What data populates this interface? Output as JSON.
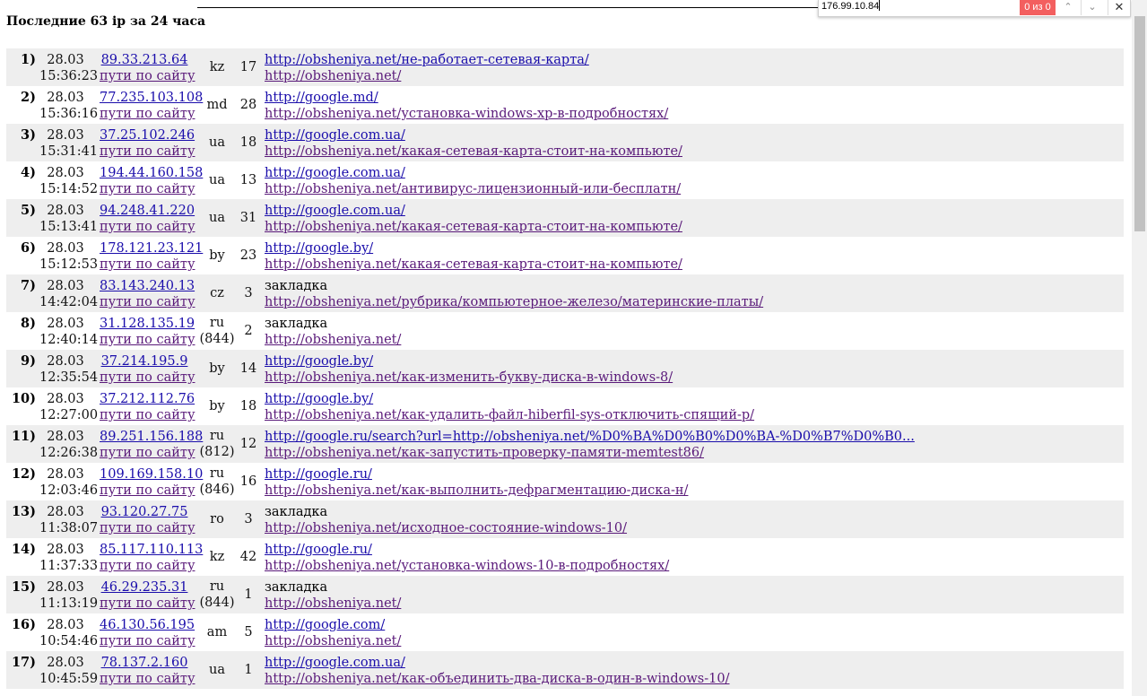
{
  "page": {
    "title": "Последние 63 ip за 24 часа"
  },
  "findbar": {
    "query": "176.99.10.84",
    "count": "0 из 0",
    "up_icon": "chevron-up-icon",
    "down_icon": "chevron-down-icon",
    "close_icon": "close-icon",
    "up_glyph": "⌃",
    "down_glyph": "⌄",
    "close_glyph": "✕"
  },
  "visits": [
    {
      "num": "1)",
      "date": "28.03",
      "time": "15:36:23",
      "ip": "89.33.213.64",
      "paths": "пути по сайту",
      "country": "kz",
      "code": "",
      "hits": "17",
      "ref": "http://obsheniya.net/не-работает-сетевая-карта/",
      "ref_link": true,
      "page": "http://obsheniya.net/"
    },
    {
      "num": "2)",
      "date": "28.03",
      "time": "15:36:16",
      "ip": "77.235.103.108",
      "paths": "пути по сайту",
      "country": "md",
      "code": "",
      "hits": "28",
      "ref": "http://google.md/",
      "ref_link": true,
      "page": "http://obsheniya.net/установка-windows-xp-в-подробностях/"
    },
    {
      "num": "3)",
      "date": "28.03",
      "time": "15:31:41",
      "ip": "37.25.102.246",
      "paths": "пути по сайту",
      "country": "ua",
      "code": "",
      "hits": "18",
      "ref": "http://google.com.ua/",
      "ref_link": true,
      "page": "http://obsheniya.net/какая-сетевая-карта-стоит-на-компьюте/"
    },
    {
      "num": "4)",
      "date": "28.03",
      "time": "15:14:52",
      "ip": "194.44.160.158",
      "paths": "пути по сайту",
      "country": "ua",
      "code": "",
      "hits": "13",
      "ref": "http://google.com.ua/",
      "ref_link": true,
      "page": "http://obsheniya.net/антивирус-лицензионный-или-бесплатн/"
    },
    {
      "num": "5)",
      "date": "28.03",
      "time": "15:13:41",
      "ip": "94.248.41.220",
      "paths": "пути по сайту",
      "country": "ua",
      "code": "",
      "hits": "31",
      "ref": "http://google.com.ua/",
      "ref_link": true,
      "page": "http://obsheniya.net/какая-сетевая-карта-стоит-на-компьюте/"
    },
    {
      "num": "6)",
      "date": "28.03",
      "time": "15:12:53",
      "ip": "178.121.23.121",
      "paths": "пути по сайту",
      "country": "by",
      "code": "",
      "hits": "23",
      "ref": "http://google.by/",
      "ref_link": true,
      "page": "http://obsheniya.net/какая-сетевая-карта-стоит-на-компьюте/"
    },
    {
      "num": "7)",
      "date": "28.03",
      "time": "14:42:04",
      "ip": "83.143.240.13",
      "paths": "пути по сайту",
      "country": "cz",
      "code": "",
      "hits": "3",
      "ref": "закладка",
      "ref_link": false,
      "page": "http://obsheniya.net/рубрика/компьютерное-железо/материнские-платы/"
    },
    {
      "num": "8)",
      "date": "28.03",
      "time": "12:40:14",
      "ip": "31.128.135.19",
      "paths": "пути по сайту",
      "country": "ru",
      "code": "(844)",
      "hits": "2",
      "ref": "закладка",
      "ref_link": false,
      "page": "http://obsheniya.net/"
    },
    {
      "num": "9)",
      "date": "28.03",
      "time": "12:35:54",
      "ip": "37.214.195.9",
      "paths": "пути по сайту",
      "country": "by",
      "code": "",
      "hits": "14",
      "ref": "http://google.by/",
      "ref_link": true,
      "page": "http://obsheniya.net/как-изменить-букву-диска-в-windows-8/"
    },
    {
      "num": "10)",
      "date": "28.03",
      "time": "12:27:00",
      "ip": "37.212.112.76",
      "paths": "пути по сайту",
      "country": "by",
      "code": "",
      "hits": "18",
      "ref": "http://google.by/",
      "ref_link": true,
      "page": "http://obsheniya.net/как-удалить-файл-hiberfil-sys-отключить-спящий-р/"
    },
    {
      "num": "11)",
      "date": "28.03",
      "time": "12:26:38",
      "ip": "89.251.156.188",
      "paths": "пути по сайту",
      "country": "ru",
      "code": "(812)",
      "hits": "12",
      "ref": "http://google.ru/search?url=http://obsheniya.net/%D0%BA%D0%B0%D0%BA-%D0%B7%D0%B0...",
      "ref_link": true,
      "page": "http://obsheniya.net/как-запустить-проверку-памяти-memtest86/"
    },
    {
      "num": "12)",
      "date": "28.03",
      "time": "12:03:46",
      "ip": "109.169.158.10",
      "paths": "пути по сайту",
      "country": "ru",
      "code": "(846)",
      "hits": "16",
      "ref": "http://google.ru/",
      "ref_link": true,
      "page": "http://obsheniya.net/как-выполнить-дефрагментацию-диска-н/"
    },
    {
      "num": "13)",
      "date": "28.03",
      "time": "11:38:07",
      "ip": "93.120.27.75",
      "paths": "пути по сайту",
      "country": "ro",
      "code": "",
      "hits": "3",
      "ref": "закладка",
      "ref_link": false,
      "page": "http://obsheniya.net/исходное-состояние-windows-10/"
    },
    {
      "num": "14)",
      "date": "28.03",
      "time": "11:37:33",
      "ip": "85.117.110.113",
      "paths": "пути по сайту",
      "country": "kz",
      "code": "",
      "hits": "42",
      "ref": "http://google.ru/",
      "ref_link": true,
      "page": "http://obsheniya.net/установка-windows-10-в-подробностях/"
    },
    {
      "num": "15)",
      "date": "28.03",
      "time": "11:13:19",
      "ip": "46.29.235.31",
      "paths": "пути по сайту",
      "country": "ru",
      "code": "(844)",
      "hits": "1",
      "ref": "закладка",
      "ref_link": false,
      "page": "http://obsheniya.net/"
    },
    {
      "num": "16)",
      "date": "28.03",
      "time": "10:54:46",
      "ip": "46.130.56.195",
      "paths": "пути по сайту",
      "country": "am",
      "code": "",
      "hits": "5",
      "ref": "http://google.com/",
      "ref_link": true,
      "page": "http://obsheniya.net/"
    },
    {
      "num": "17)",
      "date": "28.03",
      "time": "10:45:59",
      "ip": "78.137.2.160",
      "paths": "пути по сайту",
      "country": "ua",
      "code": "",
      "hits": "1",
      "ref": "http://google.com.ua/",
      "ref_link": true,
      "page": "http://obsheniya.net/как-объединить-два-диска-в-один-в-windows-10/"
    }
  ]
}
